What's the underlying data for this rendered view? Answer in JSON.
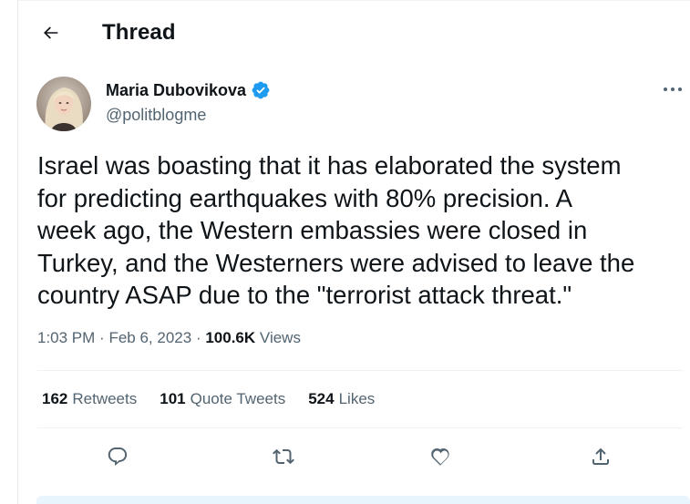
{
  "header": {
    "title": "Thread",
    "back_icon": "arrow-left-icon"
  },
  "author": {
    "name": "Maria Dubovikova",
    "handle": "@politblogme",
    "verified_icon": "verified-badge-icon",
    "verified_color": "#1d9bf0"
  },
  "tweet": {
    "text": "Israel was boasting that it has elaborated the system\nfor predicting earthquakes with 80% precision. A\nweek ago, the Western embassies were closed in\nTurkey, and the Westerners were advised to leave the\ncountry ASAP due to the \"terrorist attack threat.\"",
    "time": "1:03 PM",
    "separator": "·",
    "date": "Feb 6, 2023",
    "views_count": "100.6K",
    "views_label": "Views"
  },
  "stats": {
    "retweets_count": "162",
    "retweets_label": "Retweets",
    "quotes_count": "101",
    "quotes_label": "Quote Tweets",
    "likes_count": "524",
    "likes_label": "Likes"
  },
  "actions": [
    "reply-icon",
    "retweet-icon",
    "like-icon",
    "share-icon"
  ],
  "colors": {
    "text_primary": "#0f1419",
    "text_secondary": "#536471",
    "accent": "#1d9bf0",
    "divider": "#eff3f4"
  }
}
